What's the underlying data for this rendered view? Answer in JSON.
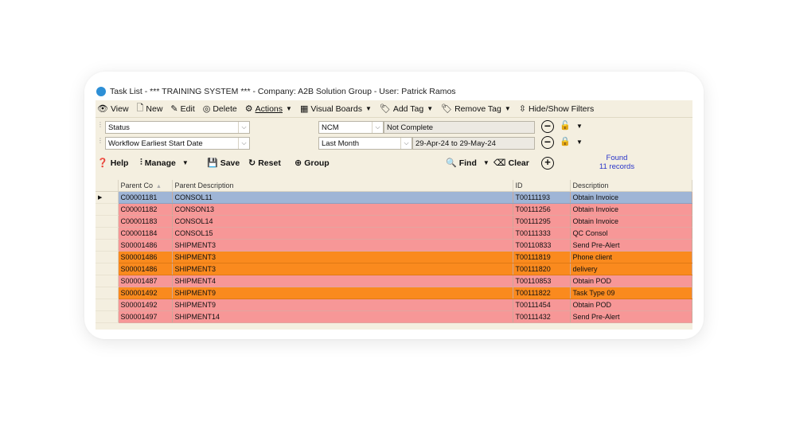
{
  "window": {
    "title": "Task List - *** TRAINING SYSTEM *** - Company: A2B Solution Group - User: Patrick Ramos"
  },
  "toolbar": {
    "view": "View",
    "new": "New",
    "edit": "Edit",
    "delete": "Delete",
    "actions": "Actions",
    "visual_boards": "Visual Boards",
    "add_tag": "Add Tag",
    "remove_tag": "Remove Tag",
    "hide_show_filters": "Hide/Show Filters"
  },
  "filters": {
    "row1": {
      "field": "Status",
      "operator": "NCM",
      "value": "Not Complete"
    },
    "row2": {
      "field": "Workflow Earliest Start Date",
      "operator": "Last Month",
      "value": "29-Apr-24 to 29-May-24"
    }
  },
  "actions_bar": {
    "help": "Help",
    "manage": "Manage",
    "save": "Save",
    "reset": "Reset",
    "group": "Group",
    "find": "Find",
    "clear": "Clear",
    "found_label": "Found",
    "found_count": "11 records"
  },
  "table": {
    "columns": [
      "Parent Co",
      "Parent Description",
      "ID",
      "Description"
    ],
    "rows": [
      {
        "parent_co": "C00001181",
        "parent_desc": "CONSOL11",
        "id": "T00111193",
        "desc": "Obtain Invoice",
        "color": "blue"
      },
      {
        "parent_co": "C00001182",
        "parent_desc": "CONSON13",
        "id": "T00111256",
        "desc": "Obtain Invoice",
        "color": "pink"
      },
      {
        "parent_co": "C00001183",
        "parent_desc": "CONSOL14",
        "id": "T00111295",
        "desc": "Obtain Invoice",
        "color": "pink"
      },
      {
        "parent_co": "C00001184",
        "parent_desc": "CONSOL15",
        "id": "T00111333",
        "desc": "QC Consol",
        "color": "pink"
      },
      {
        "parent_co": "S00001486",
        "parent_desc": "SHIPMENT3",
        "id": "T00110833",
        "desc": "Send Pre-Alert",
        "color": "pink"
      },
      {
        "parent_co": "S00001486",
        "parent_desc": "SHIPMENT3",
        "id": "T00111819",
        "desc": "Phone client",
        "color": "orange"
      },
      {
        "parent_co": "S00001486",
        "parent_desc": "SHIPMENT3",
        "id": "T00111820",
        "desc": "delivery",
        "color": "orange"
      },
      {
        "parent_co": "S00001487",
        "parent_desc": "SHIPMENT4",
        "id": "T00110853",
        "desc": "Obtain POD",
        "color": "pink"
      },
      {
        "parent_co": "S00001492",
        "parent_desc": "SHIPMENT9",
        "id": "T00111822",
        "desc": "Task Type 09",
        "color": "orange"
      },
      {
        "parent_co": "S00001492",
        "parent_desc": "SHIPMENT9",
        "id": "T00111454",
        "desc": "Obtain POD",
        "color": "pink"
      },
      {
        "parent_co": "S00001497",
        "parent_desc": "SHIPMENT14",
        "id": "T00111432",
        "desc": "Send Pre-Alert",
        "color": "pink"
      }
    ]
  },
  "colors": {
    "pink_row": "#f79797",
    "orange_row": "#fa8a1e",
    "selected_row": "#9fb5d6",
    "panel_bg": "#f4efe0",
    "found_text": "#2a35c9"
  }
}
